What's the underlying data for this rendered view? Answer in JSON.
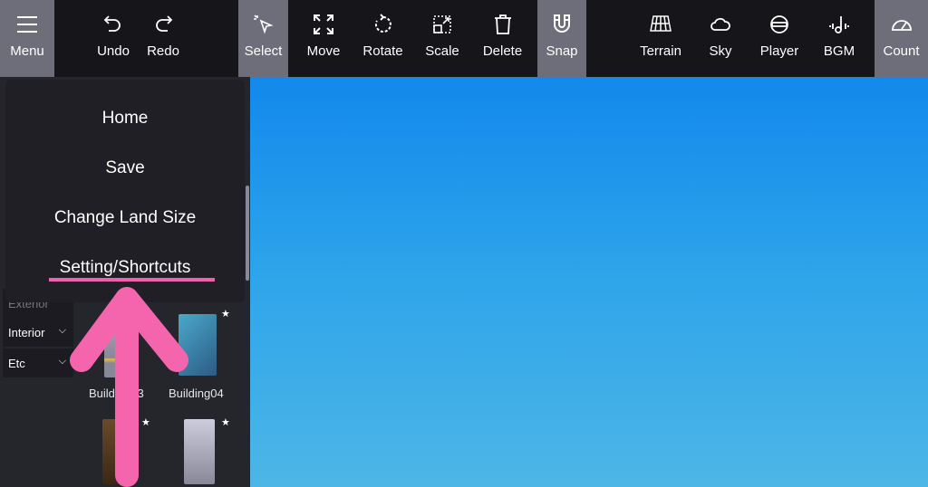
{
  "toolbar": {
    "menu": "Menu",
    "undo": "Undo",
    "redo": "Redo",
    "select": "Select",
    "move": "Move",
    "rotate": "Rotate",
    "scale": "Scale",
    "delete": "Delete",
    "snap": "Snap",
    "terrain": "Terrain",
    "sky": "Sky",
    "player": "Player",
    "bgm": "BGM",
    "count": "Count"
  },
  "menu": {
    "items": [
      "Home",
      "Save",
      "Change Land Size",
      "Setting/Shortcuts"
    ],
    "highlighted": "Setting/Shortcuts"
  },
  "categories": {
    "exterior": "Exterior",
    "interior": "Interior",
    "etc": "Etc"
  },
  "items": [
    "Building03",
    "Building04"
  ],
  "colors": {
    "accent": "#f25fae",
    "toolbar": "#15151a",
    "active": "#6e6d7a",
    "sky_top": "#1289ec",
    "sky_bottom": "#4db6e6"
  }
}
